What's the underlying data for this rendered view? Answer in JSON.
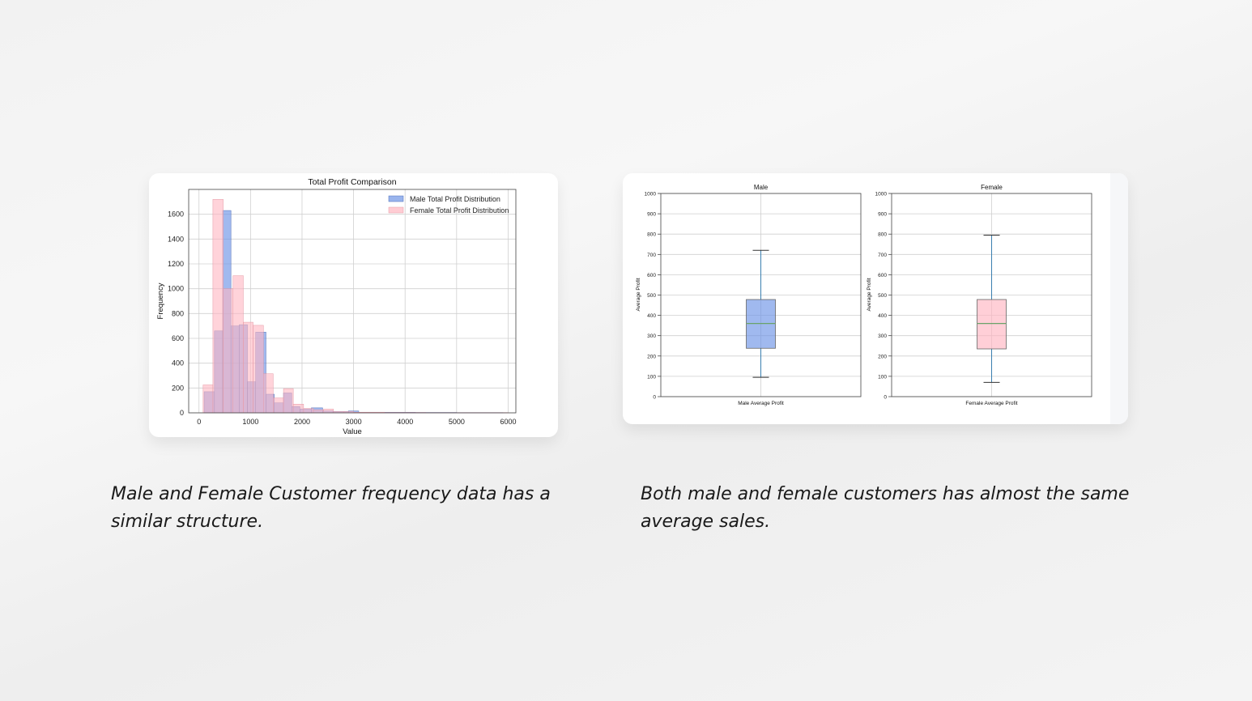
{
  "captions": {
    "left": "Male and Female Customer frequency data has a similar structure.",
    "right": "Both male and female customers has almost the same average sales."
  },
  "colors": {
    "male": "#6d94e6",
    "female": "#ffb6c1",
    "median": "#6aa36a",
    "whisker": "#3a7fb0"
  },
  "chart_data": [
    {
      "type": "bar",
      "title": "Total Profit Comparison",
      "xlabel": "Value",
      "ylabel": "Frequency",
      "xlim": [
        -200,
        6150
      ],
      "ylim": [
        0,
        1800
      ],
      "xticks": [
        0,
        1000,
        2000,
        3000,
        4000,
        5000,
        6000
      ],
      "yticks": [
        0,
        200,
        400,
        600,
        800,
        1000,
        1200,
        1400,
        1600
      ],
      "grid": true,
      "legend_position": "top-right",
      "series": [
        {
          "name": "Male Total Profit Distribution",
          "color": "#6d94e6",
          "bins": [
            [
              100,
              300,
              170
            ],
            [
              300,
              460,
              660
            ],
            [
              460,
              620,
              1630
            ],
            [
              620,
              780,
              700
            ],
            [
              780,
              940,
              710
            ],
            [
              940,
              1100,
              250
            ],
            [
              1100,
              1300,
              650
            ],
            [
              1300,
              1460,
              150
            ],
            [
              1460,
              1640,
              80
            ],
            [
              1640,
              1800,
              160
            ],
            [
              1800,
              1960,
              50
            ],
            [
              1960,
              2180,
              30
            ],
            [
              2180,
              2400,
              40
            ],
            [
              2400,
              2600,
              15
            ],
            [
              2600,
              2900,
              10
            ],
            [
              2900,
              3100,
              15
            ],
            [
              3100,
              3600,
              5
            ],
            [
              3600,
              4200,
              4
            ],
            [
              4200,
              5000,
              3
            ],
            [
              5000,
              5900,
              2
            ]
          ]
        },
        {
          "name": "Female Total Profit Distribution",
          "color": "#ffb6c1",
          "bins": [
            [
              80,
              270,
              225
            ],
            [
              270,
              470,
              1720
            ],
            [
              470,
              660,
              1000
            ],
            [
              660,
              860,
              1105
            ],
            [
              860,
              1050,
              730
            ],
            [
              1050,
              1250,
              705
            ],
            [
              1250,
              1440,
              315
            ],
            [
              1440,
              1640,
              120
            ],
            [
              1640,
              1830,
              195
            ],
            [
              1830,
              2030,
              70
            ],
            [
              2030,
              2220,
              35
            ],
            [
              2220,
              2420,
              25
            ],
            [
              2420,
              2610,
              30
            ],
            [
              2610,
              2810,
              10
            ],
            [
              2810,
              3000,
              10
            ],
            [
              3000,
              3600,
              5
            ],
            [
              3600,
              4400,
              3
            ],
            [
              4400,
              5200,
              2
            ],
            [
              5200,
              6000,
              2
            ]
          ]
        }
      ]
    },
    {
      "type": "box",
      "title": "Male",
      "xlabel": "Male Average Profit",
      "ylabel": "Average Profit",
      "ylim": [
        0,
        1000
      ],
      "yticks": [
        0,
        100,
        200,
        300,
        400,
        500,
        600,
        700,
        800,
        900,
        1000
      ],
      "grid": true,
      "box": {
        "min": 95,
        "q1": 238,
        "median": 360,
        "q3": 478,
        "max": 720
      },
      "color": "#6d94e6"
    },
    {
      "type": "box",
      "title": "Female",
      "xlabel": "Female Average Profit",
      "ylabel": "Average Profit",
      "ylim": [
        0,
        1000
      ],
      "yticks": [
        0,
        100,
        200,
        300,
        400,
        500,
        600,
        700,
        800,
        900,
        1000
      ],
      "grid": true,
      "box": {
        "min": 70,
        "q1": 235,
        "median": 360,
        "q3": 478,
        "max": 795
      },
      "color": "#ffb6c1"
    }
  ]
}
